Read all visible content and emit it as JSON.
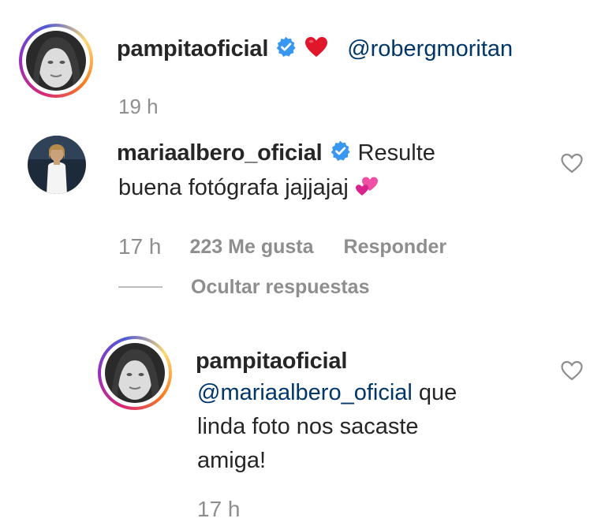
{
  "comment1": {
    "username": "pampitaoficial",
    "emoji": "❤️",
    "mention": "@robergmoritan",
    "time": "19 h"
  },
  "comment2": {
    "username": "mariaalbero_oficial",
    "text_line1": "Resulte",
    "text_line2": "buena fotógrafa jajjajaj",
    "emoji": "💕",
    "time": "17 h",
    "likes": "223 Me gusta",
    "reply_label": "Responder"
  },
  "replies_toggle": {
    "label": "Ocultar respuestas"
  },
  "reply1": {
    "username": "pampitaoficial",
    "mention": "@mariaalbero_oficial",
    "text_line1": " que",
    "text_line2": "linda foto nos sacaste",
    "text_line3": "amiga!",
    "time_partial": "17 h"
  },
  "colors": {
    "text": "#262626",
    "secondary": "#8e8e8e",
    "mention": "#00376b",
    "verified": "#3897f0",
    "heart": "#ed4956"
  },
  "icons": {
    "verified": "verified-badge-icon",
    "like": "heart-outline-icon"
  }
}
